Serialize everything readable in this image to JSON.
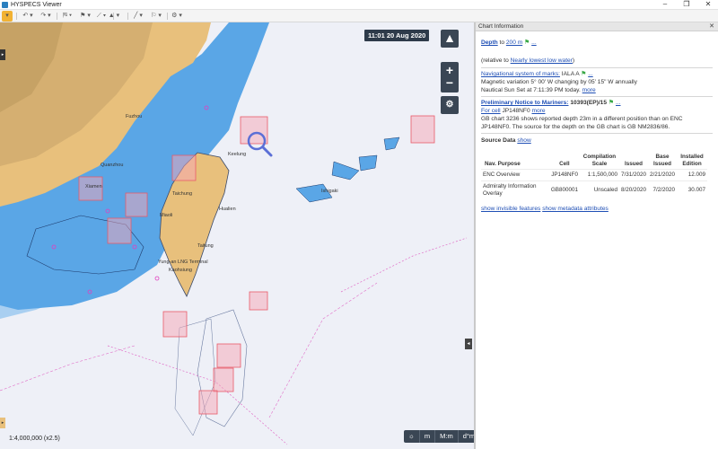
{
  "window": {
    "title": "HYSPECS Viewer",
    "controls": [
      "–",
      "❐",
      "✕"
    ]
  },
  "toolbar": {
    "buttons": [
      "▾",
      "↶ ▾",
      "↷ ▾",
      "⛿ ▾",
      "⚑ ▾",
      "⟋ ▾",
      "▲ ▾",
      "╱ ▾",
      "⚐ ▾",
      "⚙ ▾"
    ]
  },
  "map": {
    "clock": "11:01 20 Aug 2020",
    "north": "▲",
    "zoom_in": "+",
    "zoom_out": "−",
    "scale": "1:4,000,000 (x2.5)",
    "units": [
      "☼",
      "m",
      "M:m",
      "d°m'"
    ],
    "place_labels": [
      "Fuzhou",
      "Quanzhou",
      "Xiamen",
      "Taichung",
      "Keelung",
      "Hualien",
      "Yung-an LNG Terminal",
      "Kaohsiung",
      "Ishigaki",
      "Miaoli",
      "Taitung"
    ],
    "colors": {
      "land": "#e8c07c",
      "land_dark": "#c8a46a",
      "shallow_water": "#5aa6e6",
      "medium_water": "#a9cff1",
      "deep_water": "#eef0f7",
      "highlight": "#e85a6a"
    }
  },
  "panel": {
    "title": "Chart Information",
    "close": "✕",
    "depth_label": "Depth",
    "depth_to": "to",
    "depth_value": "200 m",
    "depth_relative_prefix": "(relative to",
    "depth_relative_link": "Nearly lowest low water",
    "depth_relative_suffix": ")",
    "nav_marks_label": "Navigational system of marks:",
    "nav_marks_value": "IALA A",
    "magnetic": "Magnetic variation 5° 00' W changing by 05' 15\" W annually",
    "nautical_sunset": "Nautical Sun Set at 7:11:39 PM today.",
    "more_1": "more",
    "notice_label": "Preliminary Notice to Mariners:",
    "notice_value": "10393(EP)/15",
    "notice_cell_prefix": "For cell",
    "notice_cell": "JP148NF0",
    "more_2": "more",
    "notice_text": "GB chart 3236 shows reported depth 23m in a different position than on ENC JP148NF0. The source for the depth on the GB chart is GB NM2836/86.",
    "source_data_label": "Source Data",
    "source_data_show": "show",
    "table": {
      "headers": [
        "Nav. Purpose",
        "Cell",
        "Compilation Scale",
        "Issued",
        "Base Issued",
        "Installed Edition"
      ],
      "rows": [
        [
          "ENC Overview",
          "JP148NF0",
          "1:1,500,000",
          "7/31/2020",
          "2/21/2020",
          "12.009"
        ],
        [
          "Admiralty Information Overlay",
          "GB800001",
          "Unscaled",
          "8/20/2020",
          "7/2/2020",
          "30.007"
        ]
      ]
    },
    "show_invisible": "show invisible features",
    "show_metadata": "show metadata attributes"
  }
}
